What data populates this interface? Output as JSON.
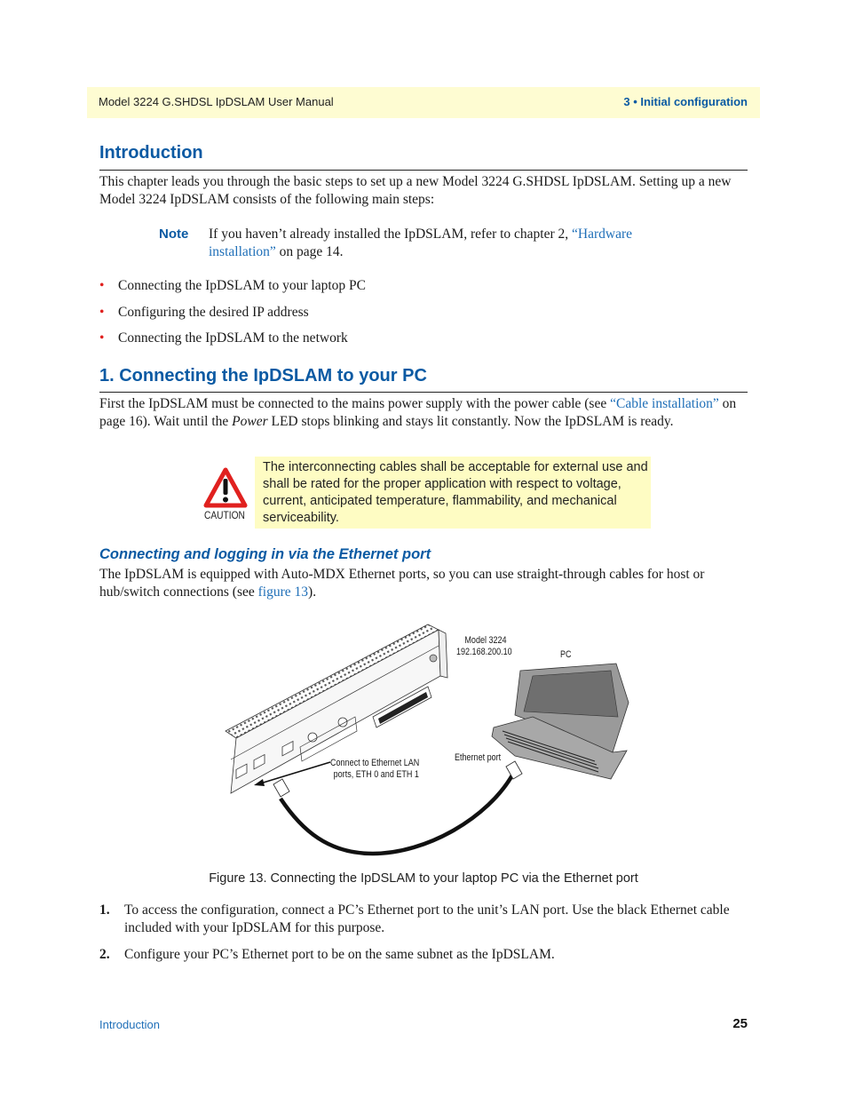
{
  "header": {
    "manual_title": "Model 3224 G.SHDSL IpDSLAM User Manual",
    "chapter": "3 • Initial configuration"
  },
  "introduction": {
    "heading": "Introduction",
    "paragraph": "This chapter leads you through the basic steps to set up a new Model 3224 G.SHDSL IpDSLAM. Setting up a new Model 3224 IpDSLAM consists of the following main steps:",
    "note": {
      "label": "Note",
      "text_before": "If you haven’t already installed the IpDSLAM, refer to chapter 2, ",
      "link": "“Hardware installation”",
      "text_after": " on page 14."
    },
    "bullets": [
      "Connecting the IpDSLAM to your laptop PC",
      "Configuring the desired IP address",
      "Connecting the IpDSLAM to the network"
    ]
  },
  "section1": {
    "heading": "1. Connecting the IpDSLAM to your PC",
    "para_before_link": "First the IpDSLAM must be connected to the mains power supply with the power cable (see ",
    "link": "“Cable installation”",
    "para_after_link_1": " on page 16). Wait until the ",
    "emphasis": "Power",
    "para_after_link_2": " LED stops blinking and stays lit constantly. Now the IpDSLAM is ready.",
    "caution": {
      "label": "CAUTION",
      "text": "The interconnecting cables shall be acceptable for external use and shall be rated for the proper application with respect to voltage, current, anticipated temperature, flammability, and mechanical serviceability."
    }
  },
  "subsection": {
    "heading": "Connecting and logging in via the Ethernet port",
    "para_before_link": "The IpDSLAM is equipped with Auto-MDX Ethernet ports, so you can use straight-through cables for host or hub/switch connections (see ",
    "link": "figure 13",
    "para_after_link": ")."
  },
  "figure": {
    "device_label_line1": "Model 3224",
    "device_label_line2": "192.168.200.10",
    "pc_label": "PC",
    "ethernet_port_label": "Ethernet port",
    "connect_label_line1": "Connect to Ethernet LAN",
    "connect_label_line2": "ports, ETH 0 and ETH 1",
    "caption": "Figure 13. Connecting the IpDSLAM to your laptop PC via the Ethernet port"
  },
  "steps": [
    {
      "num": "1.",
      "text": "To access the configuration, connect a PC’s Ethernet port to the unit’s LAN port. Use the black Ethernet cable included with your IpDSLAM for this purpose."
    },
    {
      "num": "2.",
      "text": "Configure your PC’s Ethernet port to be on the same subnet as the IpDSLAM."
    }
  ],
  "footer": {
    "section": "Introduction",
    "page_number": "25"
  }
}
